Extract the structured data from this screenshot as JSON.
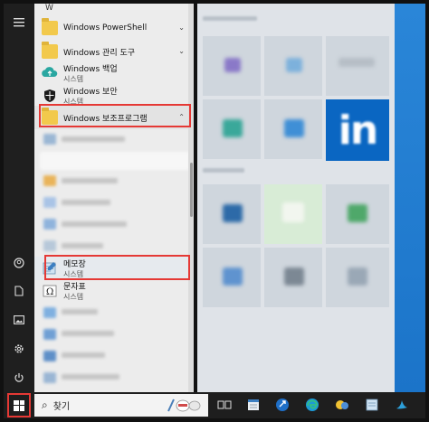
{
  "start_menu": {
    "section_letter": "W",
    "apps": [
      {
        "label": "Windows PowerShell"
      },
      {
        "label": "Windows 관리 도구"
      },
      {
        "label": "Windows 백업",
        "sub": "시스템"
      },
      {
        "label": "Windows 보안",
        "sub": "시스템"
      },
      {
        "label": "Windows 보조프로그램"
      },
      {
        "label": "메모장",
        "sub": "시스템"
      },
      {
        "label": "문자표",
        "sub": "시스템"
      }
    ]
  },
  "rail": {
    "menu_icon": "hamburger-icon",
    "user_icon": "user-icon",
    "documents_icon": "document-icon",
    "pictures_icon": "pictures-icon",
    "settings_icon": "gear-icon",
    "power_icon": "power-icon"
  },
  "taskbar": {
    "search_placeholder": "찾기",
    "icons": [
      "task-view-icon",
      "calendar-app-icon",
      "pinned-app-icon",
      "edge-icon",
      "pinned-app-icon",
      "notepad-icon",
      "pinned-app-icon"
    ]
  },
  "colors": {
    "highlight_box": "#e53935",
    "linkedin": "#0a66c2",
    "folder": "#f2c94c",
    "desktop": "#1b74c9"
  }
}
